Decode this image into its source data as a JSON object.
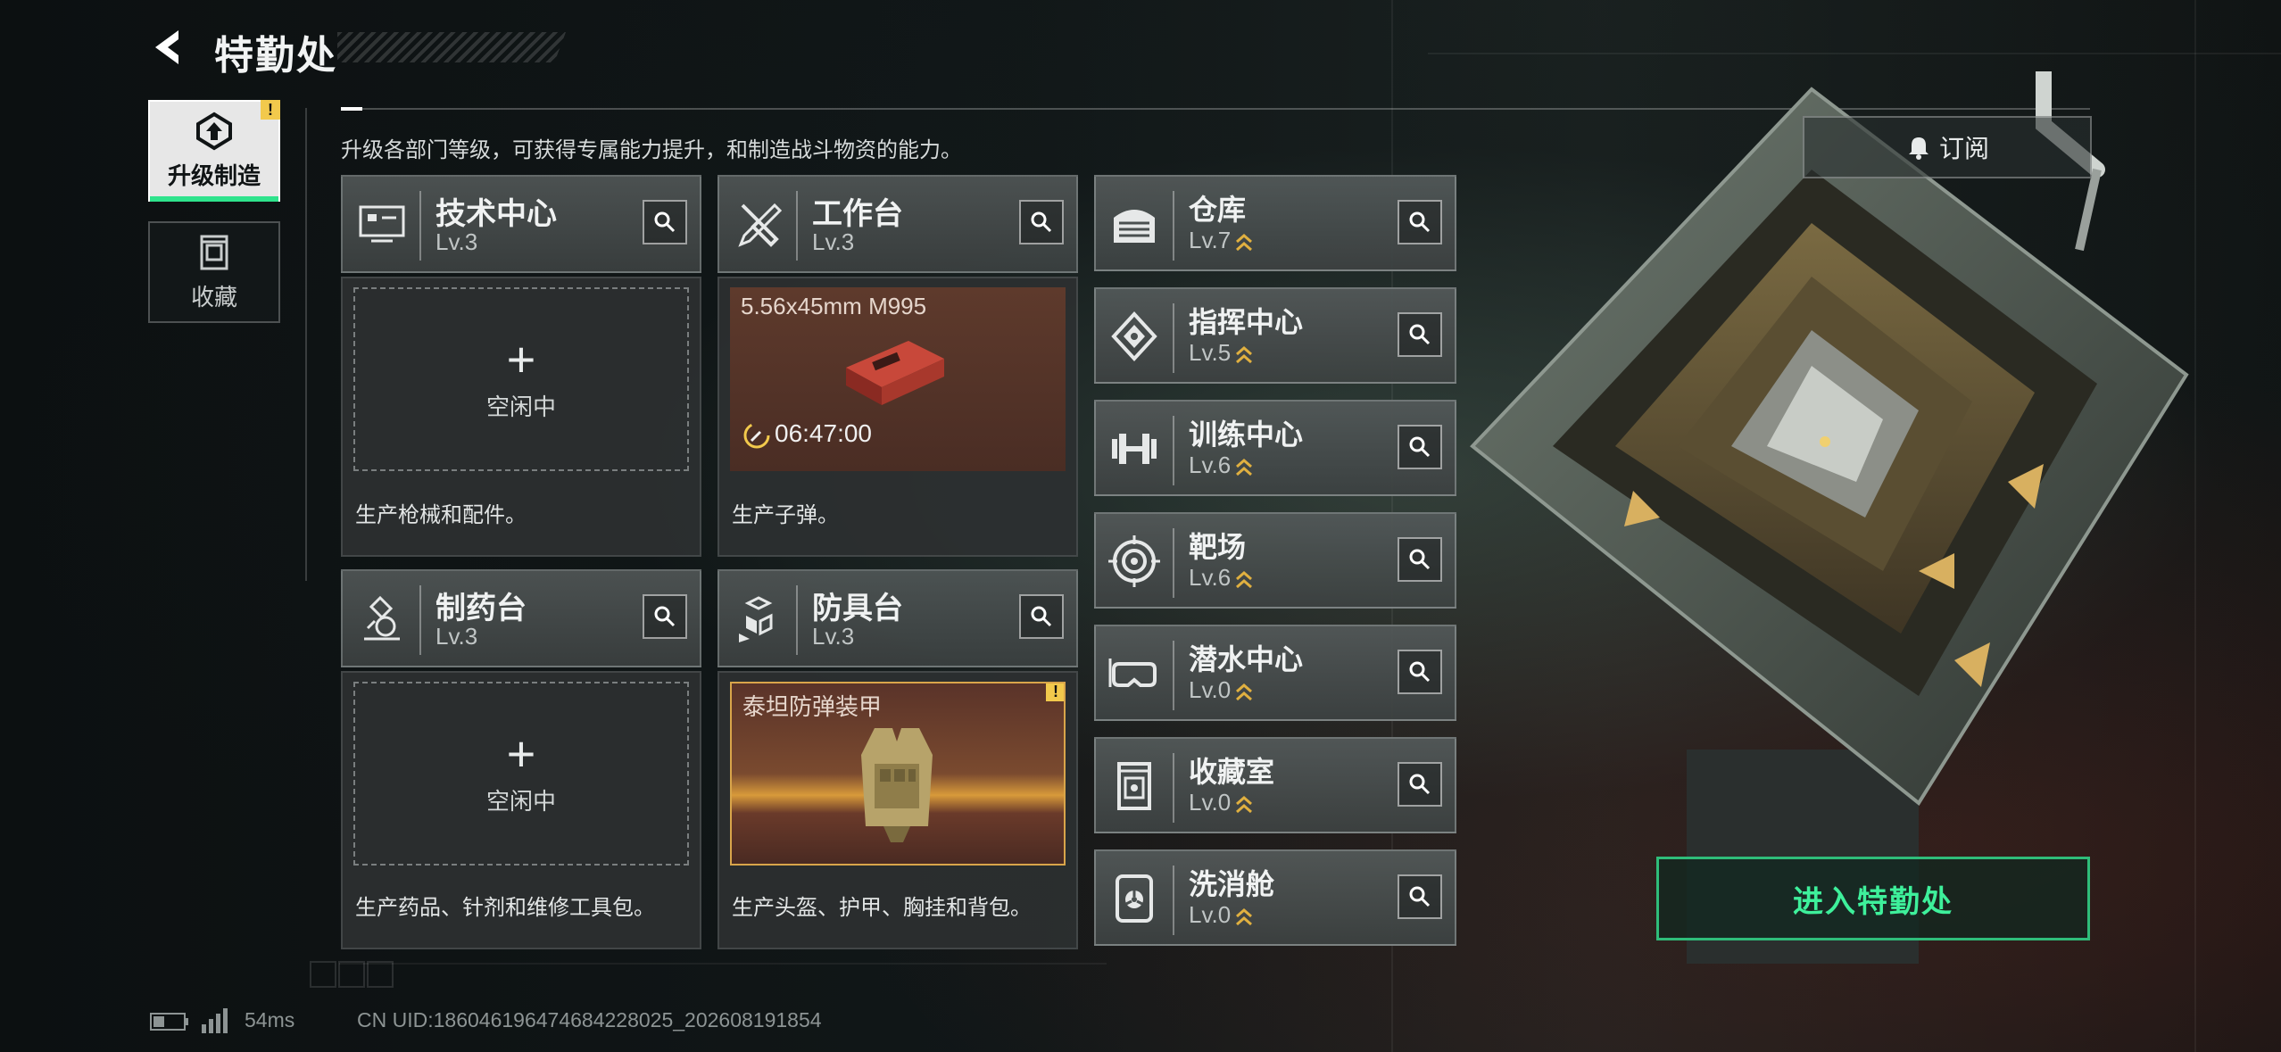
{
  "header": {
    "title": "特勤处",
    "subtitle": "升级各部门等级，可获得专属能力提升，和制造战斗物资的能力。"
  },
  "side_tabs": [
    {
      "label": "升级制造",
      "icon": "upgrade-icon",
      "active": true,
      "badge": "!"
    },
    {
      "label": "收藏",
      "icon": "collection-icon",
      "active": false
    }
  ],
  "stations": [
    {
      "name": "技术中心",
      "level": "Lv.3",
      "icon": "tech-center-icon",
      "status": "空闲中",
      "description": "生产枪械和配件。"
    },
    {
      "name": "工作台",
      "level": "Lv.3",
      "icon": "workbench-icon",
      "product": "5.56x45mm M995",
      "timer": "06:47:00",
      "description": "生产子弹。"
    },
    {
      "name": "制药台",
      "level": "Lv.3",
      "icon": "pharmacy-icon",
      "status": "空闲中",
      "description": "生产药品、针剂和维修工具包。"
    },
    {
      "name": "防具台",
      "level": "Lv.3",
      "icon": "armor-bench-icon",
      "product": "泰坦防弹装甲",
      "badge": "!",
      "description": "生产头盔、护甲、胸挂和背包。"
    }
  ],
  "facilities": [
    {
      "name": "仓库",
      "level": "Lv.7",
      "icon": "warehouse-icon"
    },
    {
      "name": "指挥中心",
      "level": "Lv.5",
      "icon": "command-center-icon"
    },
    {
      "name": "训练中心",
      "level": "Lv.6",
      "icon": "dumbbell-icon"
    },
    {
      "name": "靶场",
      "level": "Lv.6",
      "icon": "target-icon"
    },
    {
      "name": "潜水中心",
      "level": "Lv.0",
      "icon": "diving-mask-icon"
    },
    {
      "name": "收藏室",
      "level": "Lv.0",
      "icon": "collection-room-icon"
    },
    {
      "name": "洗消舱",
      "level": "Lv.0",
      "icon": "decontamination-icon"
    }
  ],
  "buttons": {
    "subscribe": "订阅",
    "enter": "进入特勤处"
  },
  "footer": {
    "ping": "54ms",
    "uid": "CN UID:186046196474684228025_202608191854"
  },
  "colors": {
    "accent_green": "#3ef09b",
    "warning_yellow": "#f2c94c",
    "upgrade_gold": "#e0b040"
  }
}
